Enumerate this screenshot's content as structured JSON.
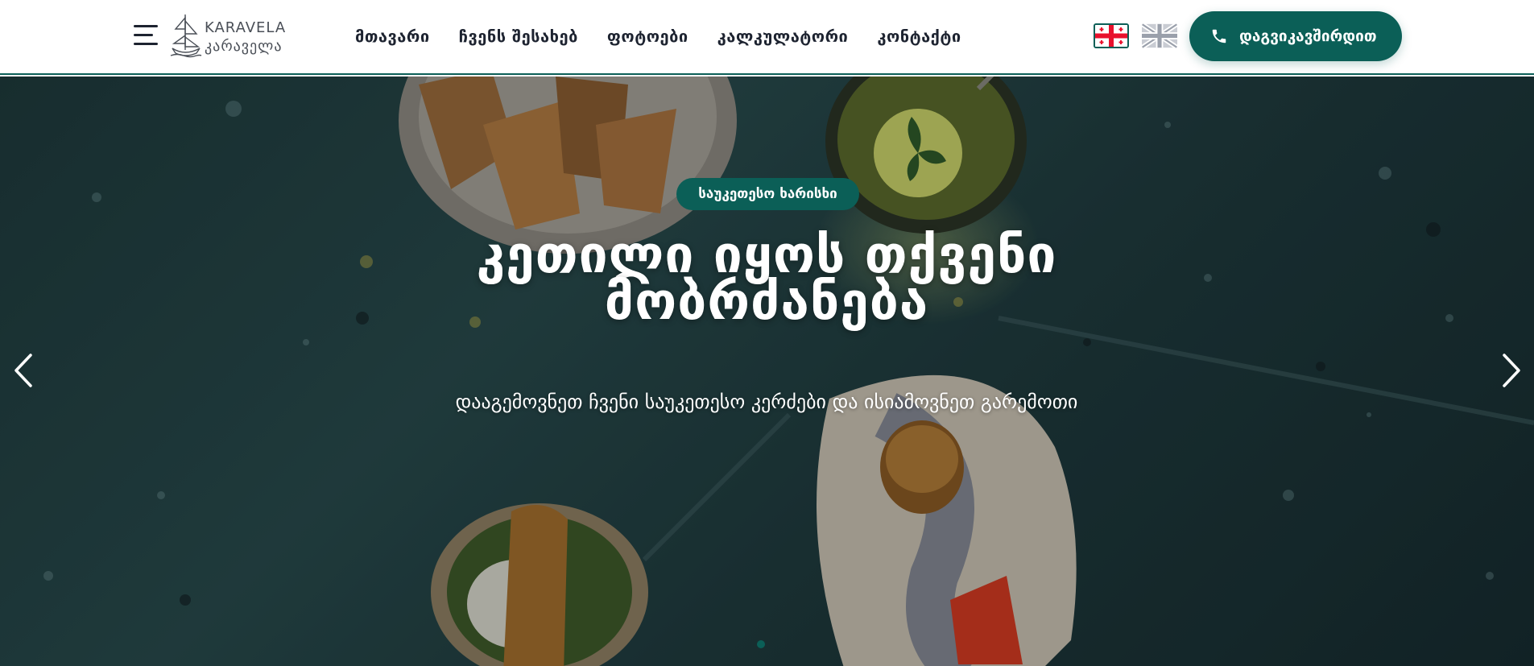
{
  "header": {
    "menu_icon": "hamburger-menu-icon",
    "logo": {
      "text_en": "KARAVELA",
      "text_ka": "კარაველა",
      "icon": "ship-icon"
    },
    "nav": [
      {
        "label": "მთავარი"
      },
      {
        "label": "ჩვენს შესახებ"
      },
      {
        "label": "ფოტოები"
      },
      {
        "label": "კალკულატორი"
      },
      {
        "label": "კონტაქტი"
      }
    ],
    "languages": [
      {
        "code": "ka",
        "icon": "georgia-flag-icon",
        "active": true
      },
      {
        "code": "en",
        "icon": "uk-flag-icon",
        "active": false
      }
    ],
    "call_button": {
      "label": "დაგვიკავშირდით",
      "icon": "phone-icon"
    }
  },
  "hero": {
    "badge": "საუკეთესო ხარისხი",
    "title_line1": "კეთილი იყოს თქვენი",
    "title_line2": "მობრძანება",
    "subtitle": "დააგემოვნეთ ჩვენი საუკეთესო კერძები და ისიამოვნეთ გარემოთი",
    "prev_icon": "chevron-left-icon",
    "next_icon": "chevron-right-icon",
    "slides_count": 1,
    "active_slide": 1
  },
  "colors": {
    "accent": "#0b5f57",
    "text_dark": "#1d2330",
    "white": "#ffffff"
  }
}
